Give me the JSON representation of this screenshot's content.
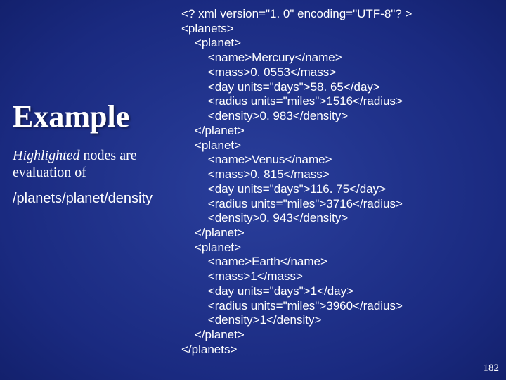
{
  "title": "Example",
  "subtitle_italic": "Highlighted",
  "subtitle_rest": " nodes are evaluation of",
  "xpath": "/planets/planet/density",
  "code": "<? xml version=\"1. 0\" encoding=\"UTF-8\"? >\n<planets>\n    <planet>\n        <name>Mercury</name>\n        <mass>0. 0553</mass>\n        <day units=\"days\">58. 65</day>\n        <radius units=\"miles\">1516</radius>\n        <density>0. 983</density>\n    </planet>\n    <planet>\n        <name>Venus</name>\n        <mass>0. 815</mass>\n        <day units=\"days\">116. 75</day>\n        <radius units=\"miles\">3716</radius>\n        <density>0. 943</density>\n    </planet>\n    <planet>\n        <name>Earth</name>\n        <mass>1</mass>\n        <day units=\"days\">1</day>\n        <radius units=\"miles\">3960</radius>\n        <density>1</density>\n    </planet>\n</planets>",
  "page_number": "182"
}
